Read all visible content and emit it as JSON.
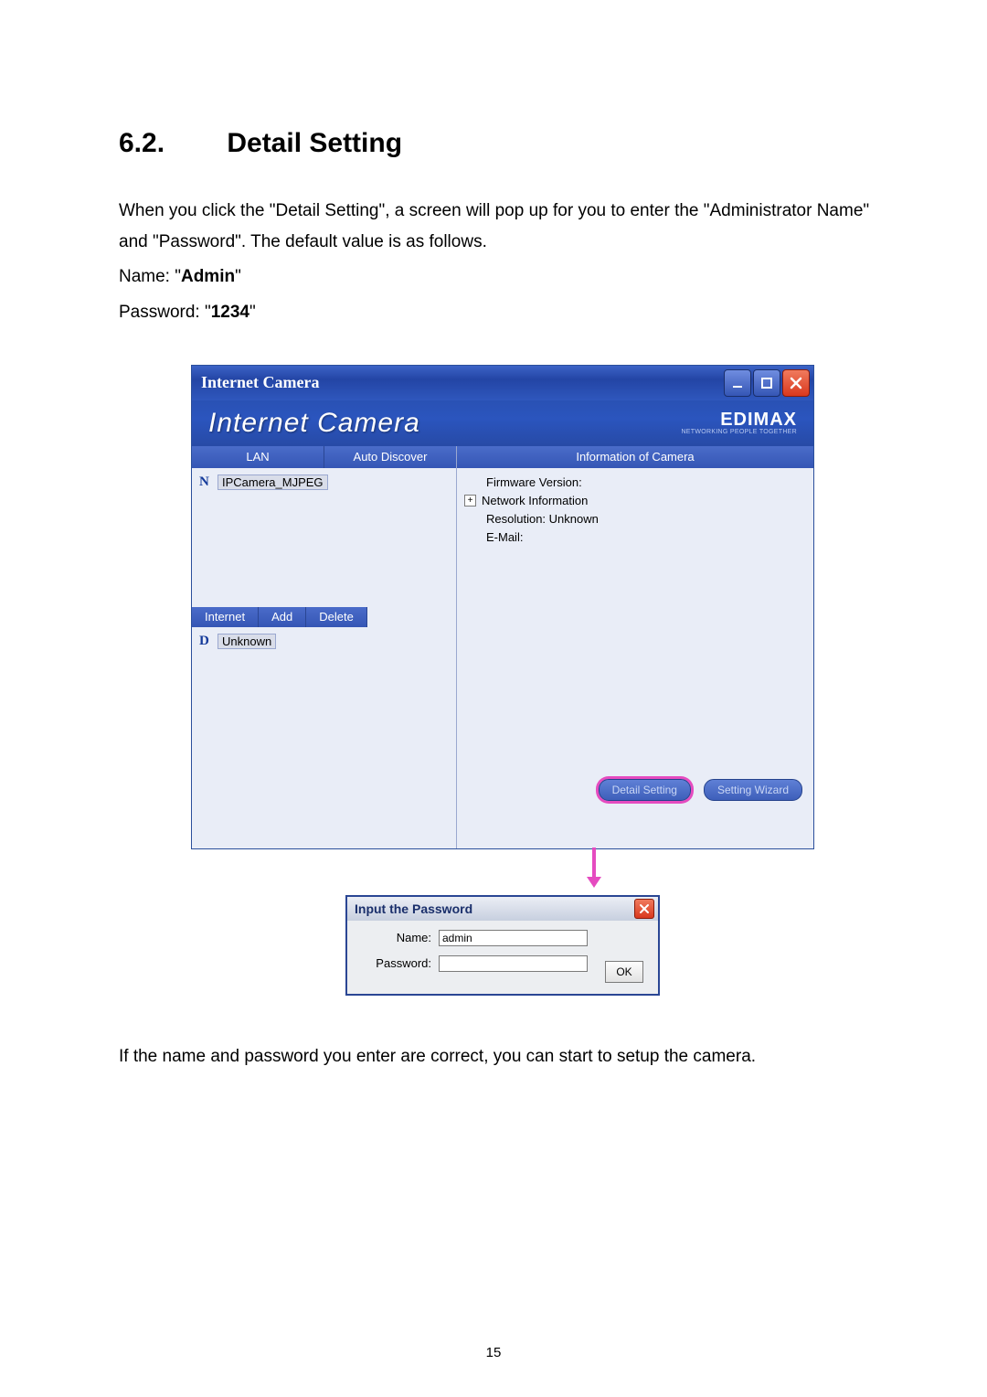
{
  "section": {
    "number": "6.2.",
    "title": "Detail Setting"
  },
  "intro": {
    "p1": "When you click the \"Detail Setting\", a screen will pop up for you to enter the \"Administrator Name\" and \"Password\". The default value is as follows.",
    "name_label": "Name: \"",
    "name_value": "Admin",
    "name_close": "\"",
    "pwd_label": "Password: \"",
    "pwd_value": "1234",
    "pwd_close": "\""
  },
  "window": {
    "title": "Internet Camera",
    "banner_product": "Internet Camera",
    "brand_name": "EDIMAX",
    "brand_tagline": "NETWORKING PEOPLE TOGETHER",
    "left_header": {
      "lan": "LAN",
      "auto_discover": "Auto Discover"
    },
    "right_header": "Information of Camera",
    "lan_items": [
      {
        "prefix": "N",
        "label": "IPCamera_MJPEG",
        "selected": true
      }
    ],
    "left_sub": {
      "internet": "Internet",
      "add": "Add",
      "delete": "Delete"
    },
    "internet_items": [
      {
        "prefix": "D",
        "label": "Unknown",
        "selected": true
      }
    ],
    "info_lines": {
      "firmware": "Firmware Version:",
      "network_info": "Network Information",
      "resolution": "Resolution: Unknown",
      "email": "E-Mail:"
    },
    "buttons": {
      "detail_setting": "Detail Setting",
      "setting_wizard": "Setting Wizard"
    }
  },
  "dialog": {
    "title": "Input the Password",
    "name_label": "Name:",
    "name_value": "admin",
    "pwd_label": "Password:",
    "pwd_value": "",
    "ok": "OK"
  },
  "outro": "If the name and password you enter are correct, you can start to setup the camera.",
  "page_number": "15"
}
